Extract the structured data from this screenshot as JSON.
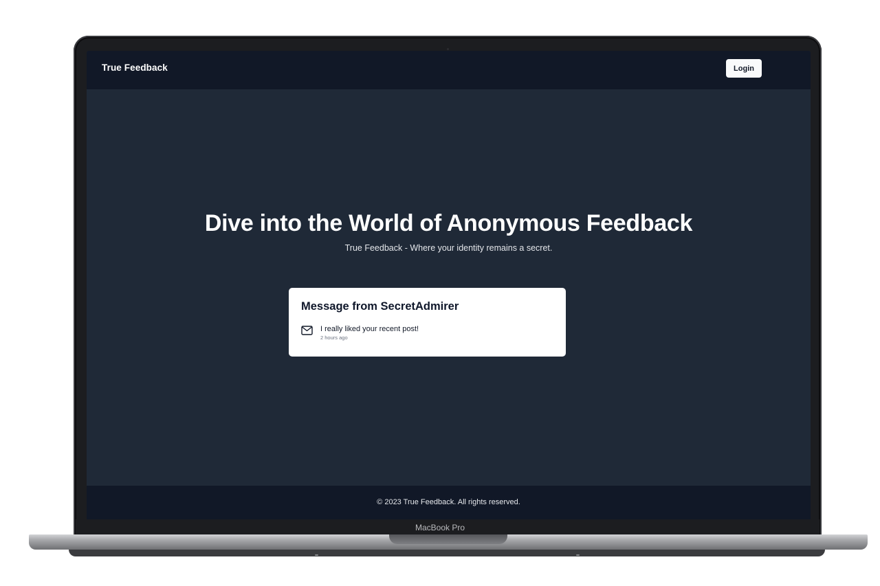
{
  "navbar": {
    "brand": "True Feedback",
    "login_label": "Login"
  },
  "hero": {
    "title": "Dive into the World of Anonymous Feedback",
    "subtitle": "True Feedback - Where your identity remains a secret."
  },
  "message_card": {
    "title": "Message from SecretAdmirer",
    "icon": "mail-icon",
    "body": "I really liked your recent post!",
    "time": "2 hours ago"
  },
  "footer": {
    "text": "© 2023 True Feedback. All rights reserved."
  },
  "device": {
    "label": "MacBook Pro"
  },
  "colors": {
    "screen_bg": "#1f2937",
    "nav_bg": "#111827",
    "card_bg": "#ffffff",
    "accent_text": "#ffffff"
  }
}
